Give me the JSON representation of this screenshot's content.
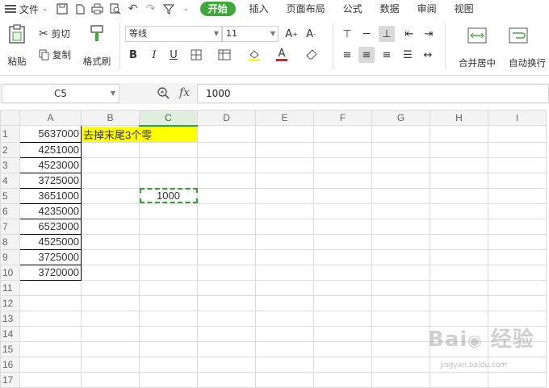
{
  "menu": {
    "file_label": "文件",
    "tabs": [
      "开始",
      "插入",
      "页面布局",
      "公式",
      "数据",
      "审阅",
      "视图"
    ],
    "active_tab": "开始"
  },
  "ribbon": {
    "paste": "粘贴",
    "cut": "剪切",
    "copy": "复制",
    "format_painter": "格式刷",
    "font_name": "等线",
    "font_size": "11",
    "merge_center": "合并居中",
    "wrap_text": "自动换行"
  },
  "formula_bar": {
    "cell_ref": "C5",
    "fx": "fx",
    "value": "1000"
  },
  "sheet": {
    "columns": [
      "A",
      "B",
      "C",
      "D",
      "E",
      "F",
      "G",
      "H",
      "I"
    ],
    "rows": [
      {
        "n": "1",
        "a": "5637000",
        "b": "去掉末尾3个零",
        "c": ""
      },
      {
        "n": "2",
        "a": "4251000",
        "b": "",
        "c": ""
      },
      {
        "n": "3",
        "a": "4523000",
        "b": "",
        "c": ""
      },
      {
        "n": "4",
        "a": "3725000",
        "b": "",
        "c": ""
      },
      {
        "n": "5",
        "a": "3651000",
        "b": "",
        "c": "1000"
      },
      {
        "n": "6",
        "a": "4235000",
        "b": "",
        "c": ""
      },
      {
        "n": "7",
        "a": "6523000",
        "b": "",
        "c": ""
      },
      {
        "n": "8",
        "a": "4525000",
        "b": "",
        "c": ""
      },
      {
        "n": "9",
        "a": "3725000",
        "b": "",
        "c": ""
      },
      {
        "n": "10",
        "a": "3720000",
        "b": "",
        "c": ""
      },
      {
        "n": "11",
        "a": "",
        "b": "",
        "c": ""
      },
      {
        "n": "12",
        "a": "",
        "b": "",
        "c": ""
      },
      {
        "n": "13",
        "a": "",
        "b": "",
        "c": ""
      },
      {
        "n": "14",
        "a": "",
        "b": "",
        "c": ""
      },
      {
        "n": "15",
        "a": "",
        "b": "",
        "c": ""
      },
      {
        "n": "16",
        "a": "",
        "b": "",
        "c": ""
      },
      {
        "n": "17",
        "a": "",
        "b": "",
        "c": ""
      }
    ],
    "highlight_color": "#ffff00",
    "selection_color": "#2fa336"
  },
  "watermark": {
    "logo": "Bai du 经验",
    "url": "jingyan.baidu.com"
  }
}
